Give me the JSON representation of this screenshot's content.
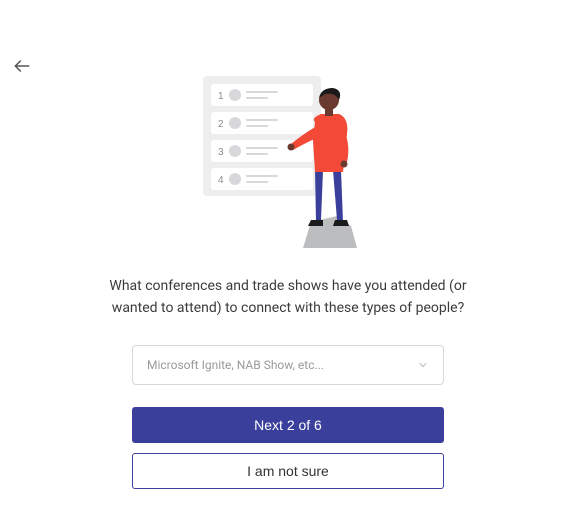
{
  "colors": {
    "accent": "#3b3f9c",
    "shirt": "#f24a37",
    "pants": "#3b3f9c",
    "board": "#eeeeef",
    "rock": "#bcbdbf"
  },
  "question": "What conferences and trade shows have you attended (or wanted to attend) to connect with these types of people?",
  "select": {
    "placeholder": "Microsoft Ignite, NAB Show, etc..."
  },
  "buttons": {
    "next": "Next 2 of 6",
    "unsure": "I am not sure"
  }
}
